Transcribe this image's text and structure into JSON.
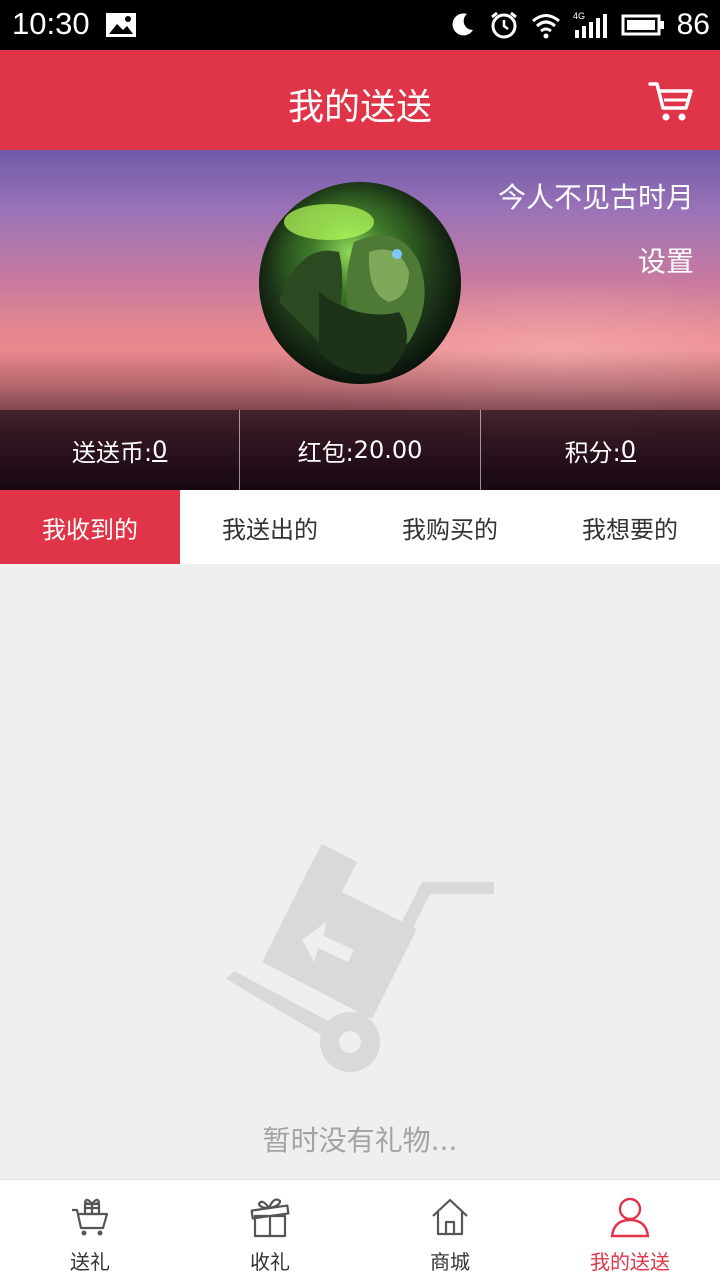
{
  "status_bar": {
    "time": "10:30",
    "network": "4G",
    "battery": "86",
    "icons": [
      "gallery-icon",
      "alarm-clock-icon",
      "wifi-icon",
      "signal-icon",
      "battery-icon"
    ]
  },
  "header": {
    "title": "我的送送",
    "cart_icon": "cart-icon",
    "color": "#e03548"
  },
  "profile": {
    "username": "今人不见古时月",
    "settings_label": "设置",
    "stats": [
      {
        "label": "送送币:",
        "value": "0"
      },
      {
        "label": "红包:",
        "value": "20.00"
      },
      {
        "label": "积分:",
        "value": "0"
      }
    ]
  },
  "tabs": [
    {
      "label": "我收到的",
      "active": true
    },
    {
      "label": "我送出的",
      "active": false
    },
    {
      "label": "我购买的",
      "active": false
    },
    {
      "label": "我想要的",
      "active": false
    }
  ],
  "empty_state": {
    "message": "暂时没有礼物...",
    "icon": "hand-truck-box-icon"
  },
  "bottom_nav": [
    {
      "label": "送礼",
      "icon": "gift-cart-icon",
      "active": false
    },
    {
      "label": "收礼",
      "icon": "gift-box-icon",
      "active": false
    },
    {
      "label": "商城",
      "icon": "home-icon",
      "active": false
    },
    {
      "label": "我的送送",
      "icon": "user-icon",
      "active": true
    }
  ],
  "colors": {
    "accent": "#e03548",
    "text": "#333333",
    "muted": "#a3a3a3",
    "background": "#efefef"
  }
}
